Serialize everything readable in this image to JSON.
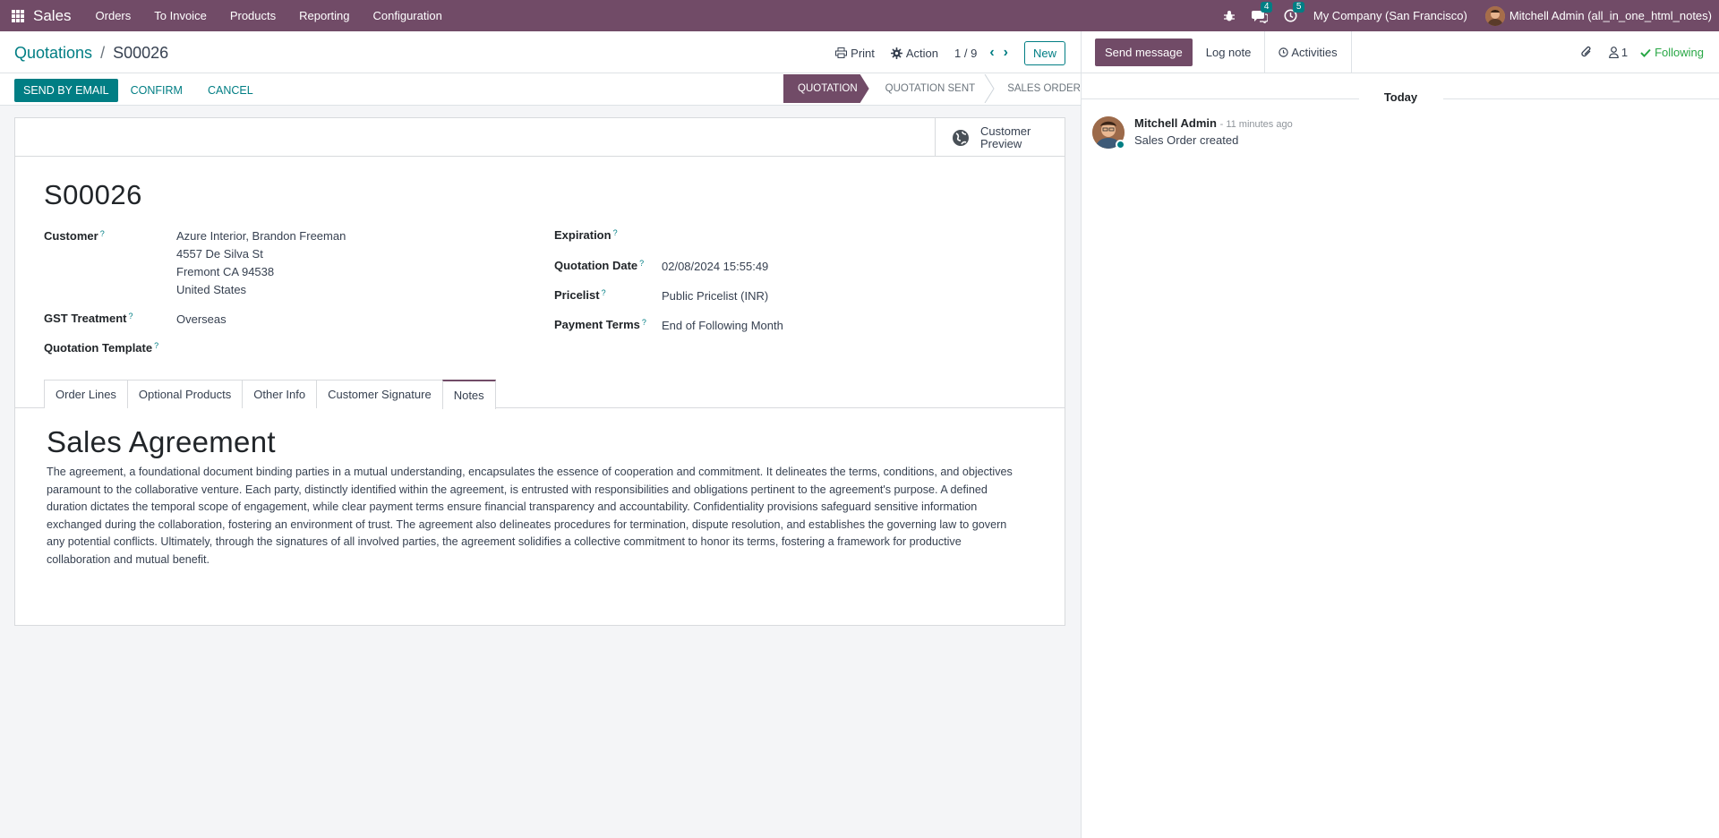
{
  "navbar": {
    "app_name": "Sales",
    "menus": [
      "Orders",
      "To Invoice",
      "Products",
      "Reporting",
      "Configuration"
    ],
    "messages_count": "4",
    "activities_count": "5",
    "company": "My Company (San Francisco)",
    "user": "Mitchell Admin (all_in_one_html_notes)"
  },
  "control_panel": {
    "breadcrumb_parent": "Quotations",
    "breadcrumb_separator": "/",
    "breadcrumb_current": "S00026",
    "print_label": "Print",
    "action_label": "Action",
    "pager": "1 / 9",
    "new_label": "New",
    "send_by_email": "Send by Email",
    "confirm": "Confirm",
    "cancel": "Cancel",
    "status_steps": [
      "Quotation",
      "Quotation Sent",
      "Sales Order"
    ],
    "active_status": "Quotation"
  },
  "sheet": {
    "customer_preview_line1": "Customer",
    "customer_preview_line2": "Preview",
    "name": "S00026",
    "fields": {
      "customer_label": "Customer",
      "customer_lines": [
        "Azure Interior, Brandon Freeman",
        "4557 De Silva St",
        "Fremont CA 94538",
        "United States"
      ],
      "gst_label": "GST Treatment",
      "gst_value": "Overseas",
      "template_label": "Quotation Template",
      "template_value": "",
      "expiration_label": "Expiration",
      "expiration_value": "",
      "date_label": "Quotation Date",
      "date_value": "02/08/2024 15:55:49",
      "pricelist_label": "Pricelist",
      "pricelist_value": "Public Pricelist (INR)",
      "terms_label": "Payment Terms",
      "terms_value": "End of Following Month",
      "help_mark": "?"
    },
    "tabs": [
      "Order Lines",
      "Optional Products",
      "Other Info",
      "Customer Signature",
      "Notes"
    ],
    "active_tab": "Notes",
    "notes": {
      "title": "Sales Agreement",
      "body": "The agreement, a foundational document binding parties in a mutual understanding, encapsulates the essence of cooperation and commitment. It delineates the terms, conditions, and objectives paramount to the collaborative venture. Each party, distinctly identified within the agreement, is entrusted with responsibilities and obligations pertinent to the agreement's purpose. A defined duration dictates the temporal scope of engagement, while clear payment terms ensure financial transparency and accountability. Confidentiality provisions safeguard sensitive information exchanged during the collaboration, fostering an environment of trust. The agreement also delineates procedures for termination, dispute resolution, and establishes the governing law to govern any potential conflicts. Ultimately, through the signatures of all involved parties, the agreement solidifies a collective commitment to honor its terms, fostering a framework for productive collaboration and mutual benefit."
    }
  },
  "chatter": {
    "send_message": "Send message",
    "log_note": "Log note",
    "activities": "Activities",
    "followers_count": "1",
    "following": "Following",
    "day_separator": "Today",
    "messages": [
      {
        "author": "Mitchell Admin",
        "date": "- 11 minutes ago",
        "text": "Sales Order created"
      }
    ]
  },
  "colors": {
    "brand": "#714b67",
    "accent": "#017e84",
    "following": "#28a745"
  }
}
